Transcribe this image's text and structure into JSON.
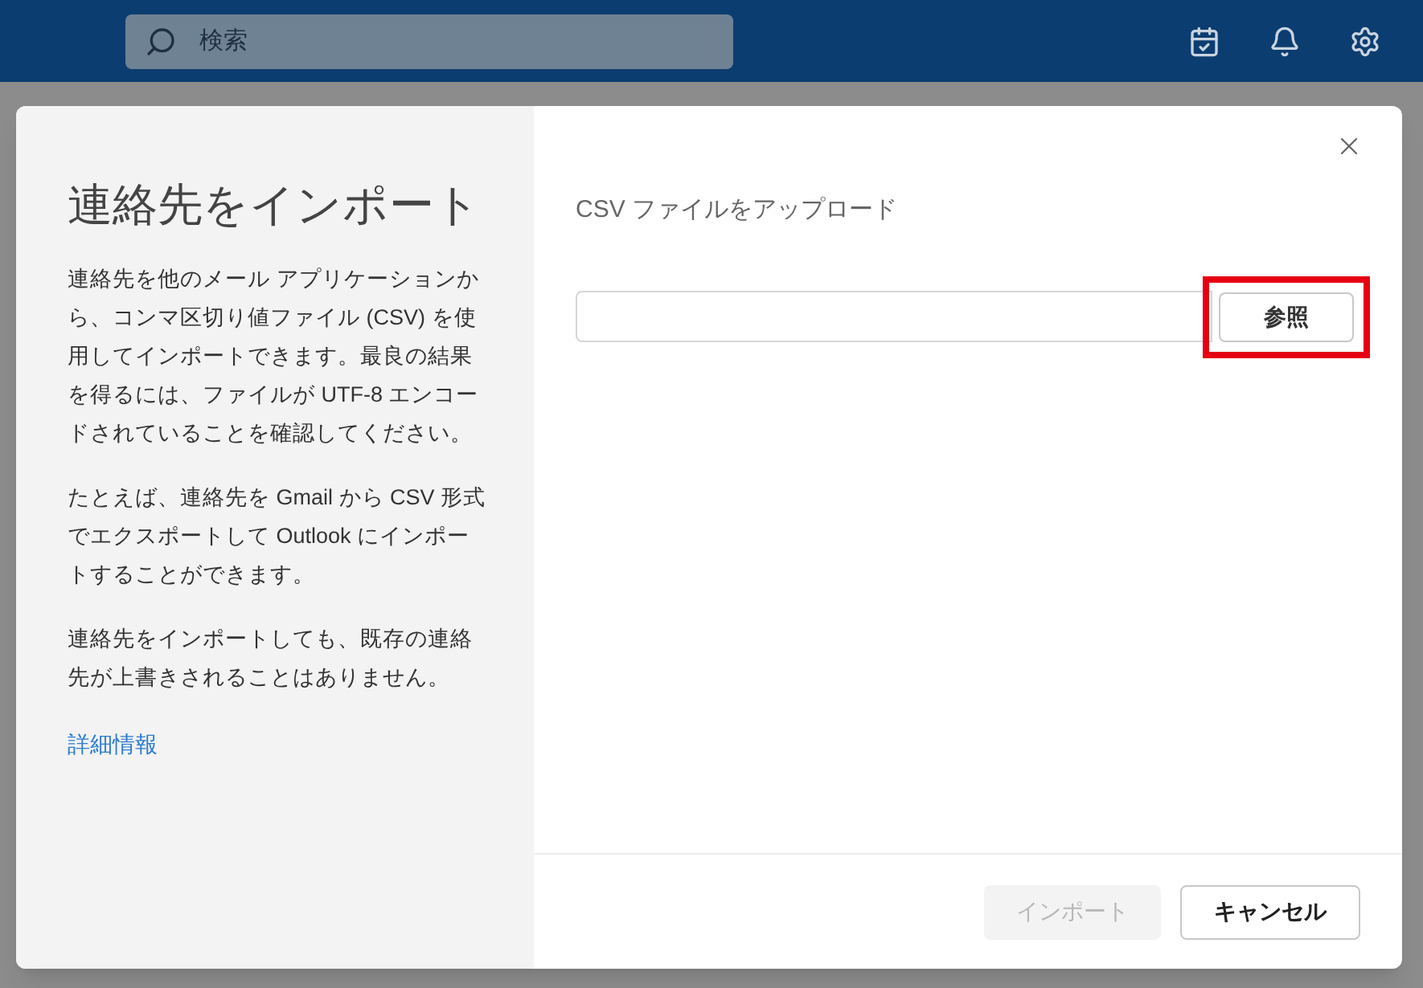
{
  "top_bar": {
    "search": {
      "placeholder": "検索"
    }
  },
  "dialog": {
    "title": "連絡先をインポート",
    "paragraphs": [
      "連絡先を他のメール アプリケーションから、コンマ区切り値ファイル (CSV) を使用してインポートできます。最良の結果を得るには、ファイルが UTF-8 エンコードされていることを確認してください。",
      "たとえば、連絡先を Gmail から CSV 形式でエクスポートして Outlook にインポートすることができます。",
      "連絡先をインポートしても、既存の連絡先が上書きされることはありません。"
    ],
    "link": "詳細情報",
    "upload_label": "CSV ファイルをアップロード",
    "browse_button": {
      "label": "参照",
      "highlighted": true
    },
    "buttons": [
      {
        "label": "インポート",
        "disabled": true
      },
      {
        "label": "キャンセル",
        "disabled": false
      }
    ]
  }
}
